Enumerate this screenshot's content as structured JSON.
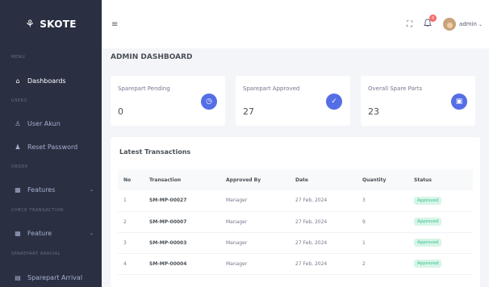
{
  "brand": {
    "name": "SKOTE",
    "logo_glyph": "⚘"
  },
  "sidebar": {
    "sections": [
      "MENU",
      "USERS",
      "ORDER",
      "CHECK TRANSACTION",
      "SPAREPART ARRIVAL"
    ],
    "items": [
      {
        "label": "Dashboards",
        "icon": "home-icon",
        "glyph": "⌂",
        "active": true
      },
      {
        "label": "User Akun",
        "icon": "user-icon",
        "glyph": "♙"
      },
      {
        "label": "Reset Password",
        "icon": "user-reset-icon",
        "glyph": "♟"
      },
      {
        "label": "Features",
        "icon": "grid-icon",
        "glyph": "▦",
        "has_chevron": true
      },
      {
        "label": "Feature",
        "icon": "grid-icon",
        "glyph": "▦",
        "has_chevron": true
      },
      {
        "label": "Sparepart Arrival",
        "icon": "box-icon",
        "glyph": "▤"
      }
    ]
  },
  "topbar": {
    "menu_glyph": "≡",
    "fullscreen_glyph": "⛶",
    "bell_glyph": "🔔",
    "notification_count": "0",
    "user_name": "admin",
    "caret": "⌄"
  },
  "page": {
    "title": "ADMIN DASHBOARD"
  },
  "stats": [
    {
      "label": "Sparepart Pending",
      "value": "0",
      "icon": "clock-icon",
      "glyph": "◷"
    },
    {
      "label": "Sparepart Approved",
      "value": "27",
      "icon": "check-circle-icon",
      "glyph": "✓"
    },
    {
      "label": "Overall Spare Parts",
      "value": "23",
      "icon": "clipboard-icon",
      "glyph": "▣"
    }
  ],
  "transactions": {
    "title": "Latest Transactions",
    "columns": [
      "No",
      "Transaction",
      "Approved By",
      "Date",
      "Quantity",
      "Status"
    ],
    "rows": [
      {
        "no": "1",
        "transaction": "SM-MP-00027",
        "approved_by": "Manager",
        "date": "27 Feb, 2024",
        "quantity": "3",
        "status": "Approved"
      },
      {
        "no": "2",
        "transaction": "SM-MP-00007",
        "approved_by": "Manager",
        "date": "27 Feb, 2024",
        "quantity": "9",
        "status": "Approved"
      },
      {
        "no": "3",
        "transaction": "SM-MP-00003",
        "approved_by": "Manager",
        "date": "27 Feb, 2024",
        "quantity": "1",
        "status": "Approved"
      },
      {
        "no": "4",
        "transaction": "SM-MP-00004",
        "approved_by": "Manager",
        "date": "27 Feb, 2024",
        "quantity": "2",
        "status": "Approved"
      }
    ]
  },
  "colors": {
    "sidebar": "#2a3042",
    "accent": "#556ee6",
    "success": "#34c38f"
  }
}
